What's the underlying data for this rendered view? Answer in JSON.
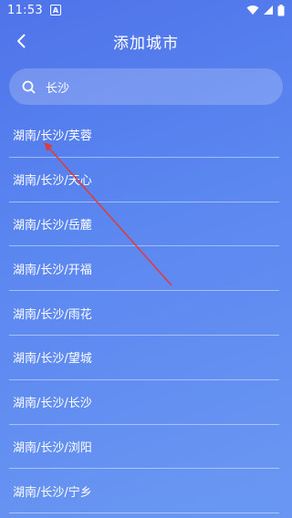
{
  "status_bar": {
    "time": "11:53",
    "notification_icon": "A"
  },
  "header": {
    "title": "添加城市"
  },
  "search": {
    "value": "长沙",
    "placeholder": ""
  },
  "cities": [
    {
      "label": "湖南/长沙/芙蓉"
    },
    {
      "label": "湖南/长沙/天心"
    },
    {
      "label": "湖南/长沙/岳麓"
    },
    {
      "label": "湖南/长沙/开福"
    },
    {
      "label": "湖南/长沙/雨花"
    },
    {
      "label": "湖南/长沙/望城"
    },
    {
      "label": "湖南/长沙/长沙"
    },
    {
      "label": "湖南/长沙/浏阳"
    },
    {
      "label": "湖南/长沙/宁乡"
    }
  ],
  "colors": {
    "background_start": "#4f73ea",
    "background_end": "#6b97f3",
    "annotation_arrow": "#e03a3a"
  },
  "icons": [
    "back-icon",
    "search-icon",
    "wifi-icon",
    "signal-icon",
    "battery-icon"
  ]
}
